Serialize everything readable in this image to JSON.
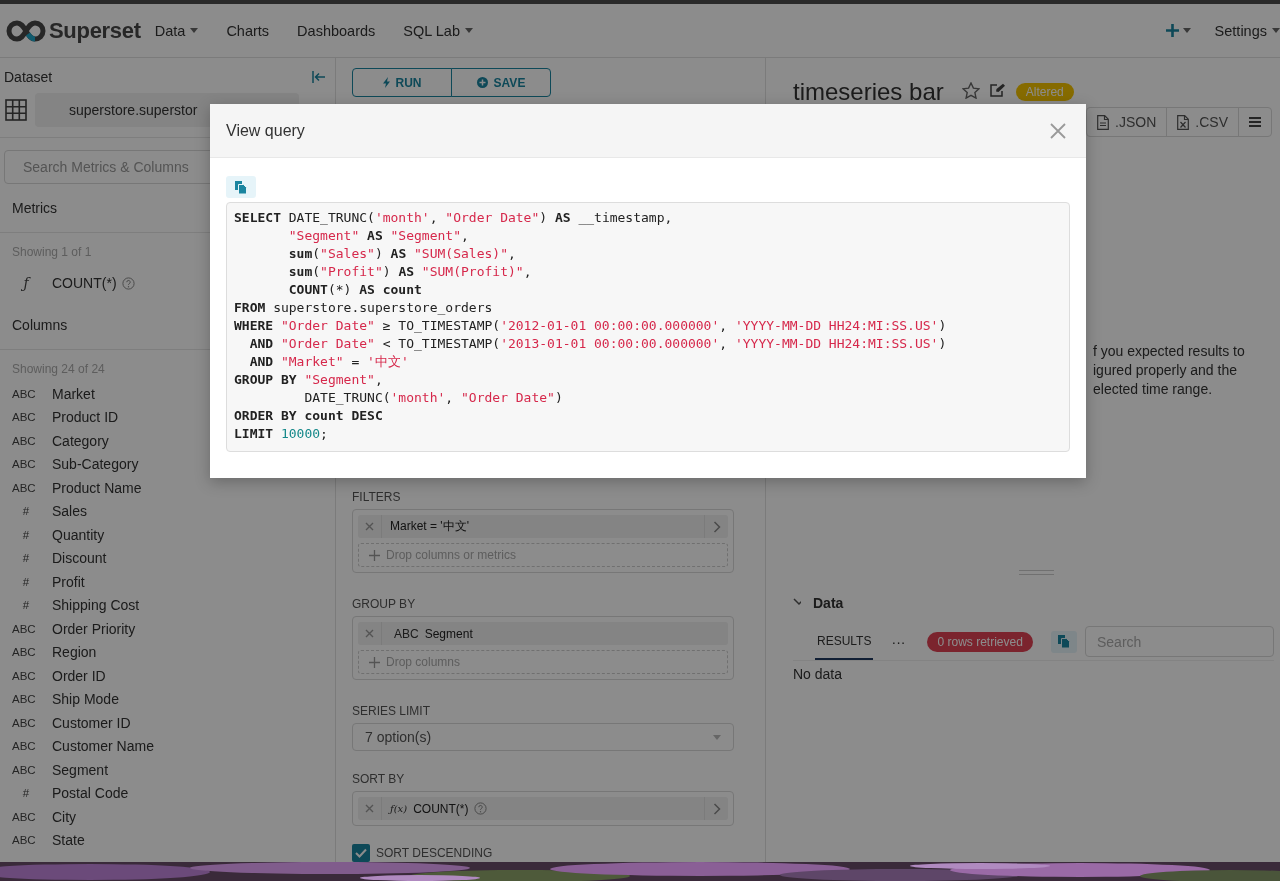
{
  "navbar": {
    "brand": "Superset",
    "menu": [
      {
        "label": "Data",
        "dropdown": true
      },
      {
        "label": "Charts",
        "dropdown": false
      },
      {
        "label": "Dashboards",
        "dropdown": false
      },
      {
        "label": "SQL Lab",
        "dropdown": true
      }
    ],
    "settings": {
      "label": "Settings",
      "dropdown": true
    }
  },
  "sidebar": {
    "title": "Dataset",
    "dataset": "superstore.superstor",
    "search": {
      "placeholder": "Search Metrics & Columns"
    },
    "metrics": {
      "title": "Metrics",
      "count": "Showing 1 of 1",
      "items": [
        {
          "type_label": "ƒ",
          "name": "COUNT(*)",
          "help": true
        }
      ]
    },
    "columns": {
      "title": "Columns",
      "count": "Showing 24 of 24",
      "items": [
        {
          "type_label": "ABC",
          "name": "Market"
        },
        {
          "type_label": "ABC",
          "name": "Product ID"
        },
        {
          "type_label": "ABC",
          "name": "Category"
        },
        {
          "type_label": "ABC",
          "name": "Sub-Category"
        },
        {
          "type_label": "ABC",
          "name": "Product Name"
        },
        {
          "type_label": "#",
          "name": "Sales"
        },
        {
          "type_label": "#",
          "name": "Quantity"
        },
        {
          "type_label": "#",
          "name": "Discount"
        },
        {
          "type_label": "#",
          "name": "Profit"
        },
        {
          "type_label": "#",
          "name": "Shipping Cost"
        },
        {
          "type_label": "ABC",
          "name": "Order Priority"
        },
        {
          "type_label": "ABC",
          "name": "Region"
        },
        {
          "type_label": "ABC",
          "name": "Order ID"
        },
        {
          "type_label": "ABC",
          "name": "Ship Mode"
        },
        {
          "type_label": "ABC",
          "name": "Customer ID"
        },
        {
          "type_label": "ABC",
          "name": "Customer Name"
        },
        {
          "type_label": "ABC",
          "name": "Segment"
        },
        {
          "type_label": "#",
          "name": "Postal Code"
        },
        {
          "type_label": "ABC",
          "name": "City"
        },
        {
          "type_label": "ABC",
          "name": "State"
        }
      ]
    }
  },
  "controls": {
    "run": "RUN",
    "save": "SAVE",
    "filters": {
      "label": "FILTERS",
      "items": [
        {
          "text": "Market = '中文'",
          "expandable": true
        }
      ],
      "placeholder": "Drop columns or metrics"
    },
    "group_by": {
      "label": "GROUP BY",
      "items": [
        {
          "type_label": "ABC",
          "text": "Segment",
          "expandable": false
        }
      ],
      "placeholder": "Drop columns"
    },
    "series_limit": {
      "label": "SERIES LIMIT",
      "value": "7 option(s)"
    },
    "sort_by": {
      "label": "SORT BY",
      "items": [
        {
          "type_label": "ƒ(x)",
          "text": "COUNT(*)",
          "help": true,
          "expandable": true
        }
      ]
    },
    "sort_descending": {
      "label": "SORT DESCENDING",
      "checked": true
    }
  },
  "chart": {
    "title": "timeseries bar",
    "starred": false,
    "status": "Altered",
    "actions": [
      {
        "kind": "file",
        "label": ".JSON"
      },
      {
        "kind": "sheet",
        "label": ".CSV"
      },
      {
        "kind": "menu"
      }
    ],
    "message": [
      "f you expected results to",
      "igured properly and the",
      "elected time range."
    ]
  },
  "data_pane": {
    "title": "Data",
    "expanded": true,
    "tabs": [
      {
        "label": "RESULTS",
        "selected": true
      }
    ],
    "more": "···",
    "badge": "0 rows retrieved",
    "search": {
      "placeholder": "Search"
    },
    "empty": "No data"
  },
  "modal": {
    "title": "View query",
    "code": [
      [
        {
          "kind": "keyword",
          "text": "SELECT"
        },
        " DATE_TRUNC(",
        {
          "kind": "string",
          "text": "'month'"
        },
        ", ",
        {
          "kind": "string",
          "text": "\"Order Date\""
        },
        ") ",
        {
          "kind": "keyword",
          "text": "AS"
        },
        " __timestamp,"
      ],
      [
        {
          "kind": "string",
          "text": "       \"Segment\""
        },
        {
          "kind": "keyword",
          "text": " AS"
        },
        {
          "kind": "string",
          "text": " \"Segment\""
        },
        ","
      ],
      [
        {
          "kind": "keyword",
          "text": "       sum"
        },
        "(",
        {
          "kind": "string",
          "text": "\"Sales\""
        },
        ") ",
        {
          "kind": "keyword",
          "text": "AS"
        },
        {
          "kind": "string",
          "text": " \"SUM(Sales)\""
        },
        ","
      ],
      [
        {
          "kind": "keyword",
          "text": "       sum"
        },
        "(",
        {
          "kind": "string",
          "text": "\"Profit\""
        },
        ") ",
        {
          "kind": "keyword",
          "text": "AS"
        },
        {
          "kind": "string",
          "text": " \"SUM(Profit)\""
        },
        ","
      ],
      [
        {
          "kind": "keyword",
          "text": "       COUNT"
        },
        "(*) ",
        {
          "kind": "keyword",
          "text": "AS count"
        }
      ],
      [
        {
          "kind": "keyword",
          "text": "FROM"
        },
        " superstore.superstore_orders"
      ],
      [
        {
          "kind": "keyword",
          "text": "WHERE"
        },
        {
          "kind": "string",
          "text": " \"Order Date\""
        },
        " ≥ TO_TIMESTAMP(",
        {
          "kind": "string",
          "text": "'2012-01-01 00:00:00.000000'"
        },
        ", ",
        {
          "kind": "string",
          "text": "'YYYY-MM-DD HH24:MI:SS.US'"
        },
        ")"
      ],
      [
        {
          "kind": "keyword",
          "text": "  AND"
        },
        {
          "kind": "string",
          "text": " \"Order Date\""
        },
        " < TO_TIMESTAMP(",
        {
          "kind": "string",
          "text": "'2013-01-01 00:00:00.000000'"
        },
        ", ",
        {
          "kind": "string",
          "text": "'YYYY-MM-DD HH24:MI:SS.US'"
        },
        ")"
      ],
      [
        {
          "kind": "keyword",
          "text": "  AND"
        },
        {
          "kind": "string",
          "text": " \"Market\""
        },
        " = ",
        {
          "kind": "string",
          "text": "'中文'"
        }
      ],
      [
        {
          "kind": "keyword",
          "text": "GROUP BY"
        },
        {
          "kind": "string",
          "text": " \"Segment\""
        },
        ","
      ],
      [
        "         DATE_TRUNC(",
        {
          "kind": "string",
          "text": "'month'"
        },
        ", ",
        {
          "kind": "string",
          "text": "\"Order Date\""
        },
        ")"
      ],
      [
        {
          "kind": "keyword",
          "text": "ORDER BY count DESC"
        }
      ],
      [
        {
          "kind": "keyword",
          "text": "LIMIT"
        },
        {
          "kind": "number",
          "text": " 10000"
        },
        ";"
      ]
    ]
  }
}
